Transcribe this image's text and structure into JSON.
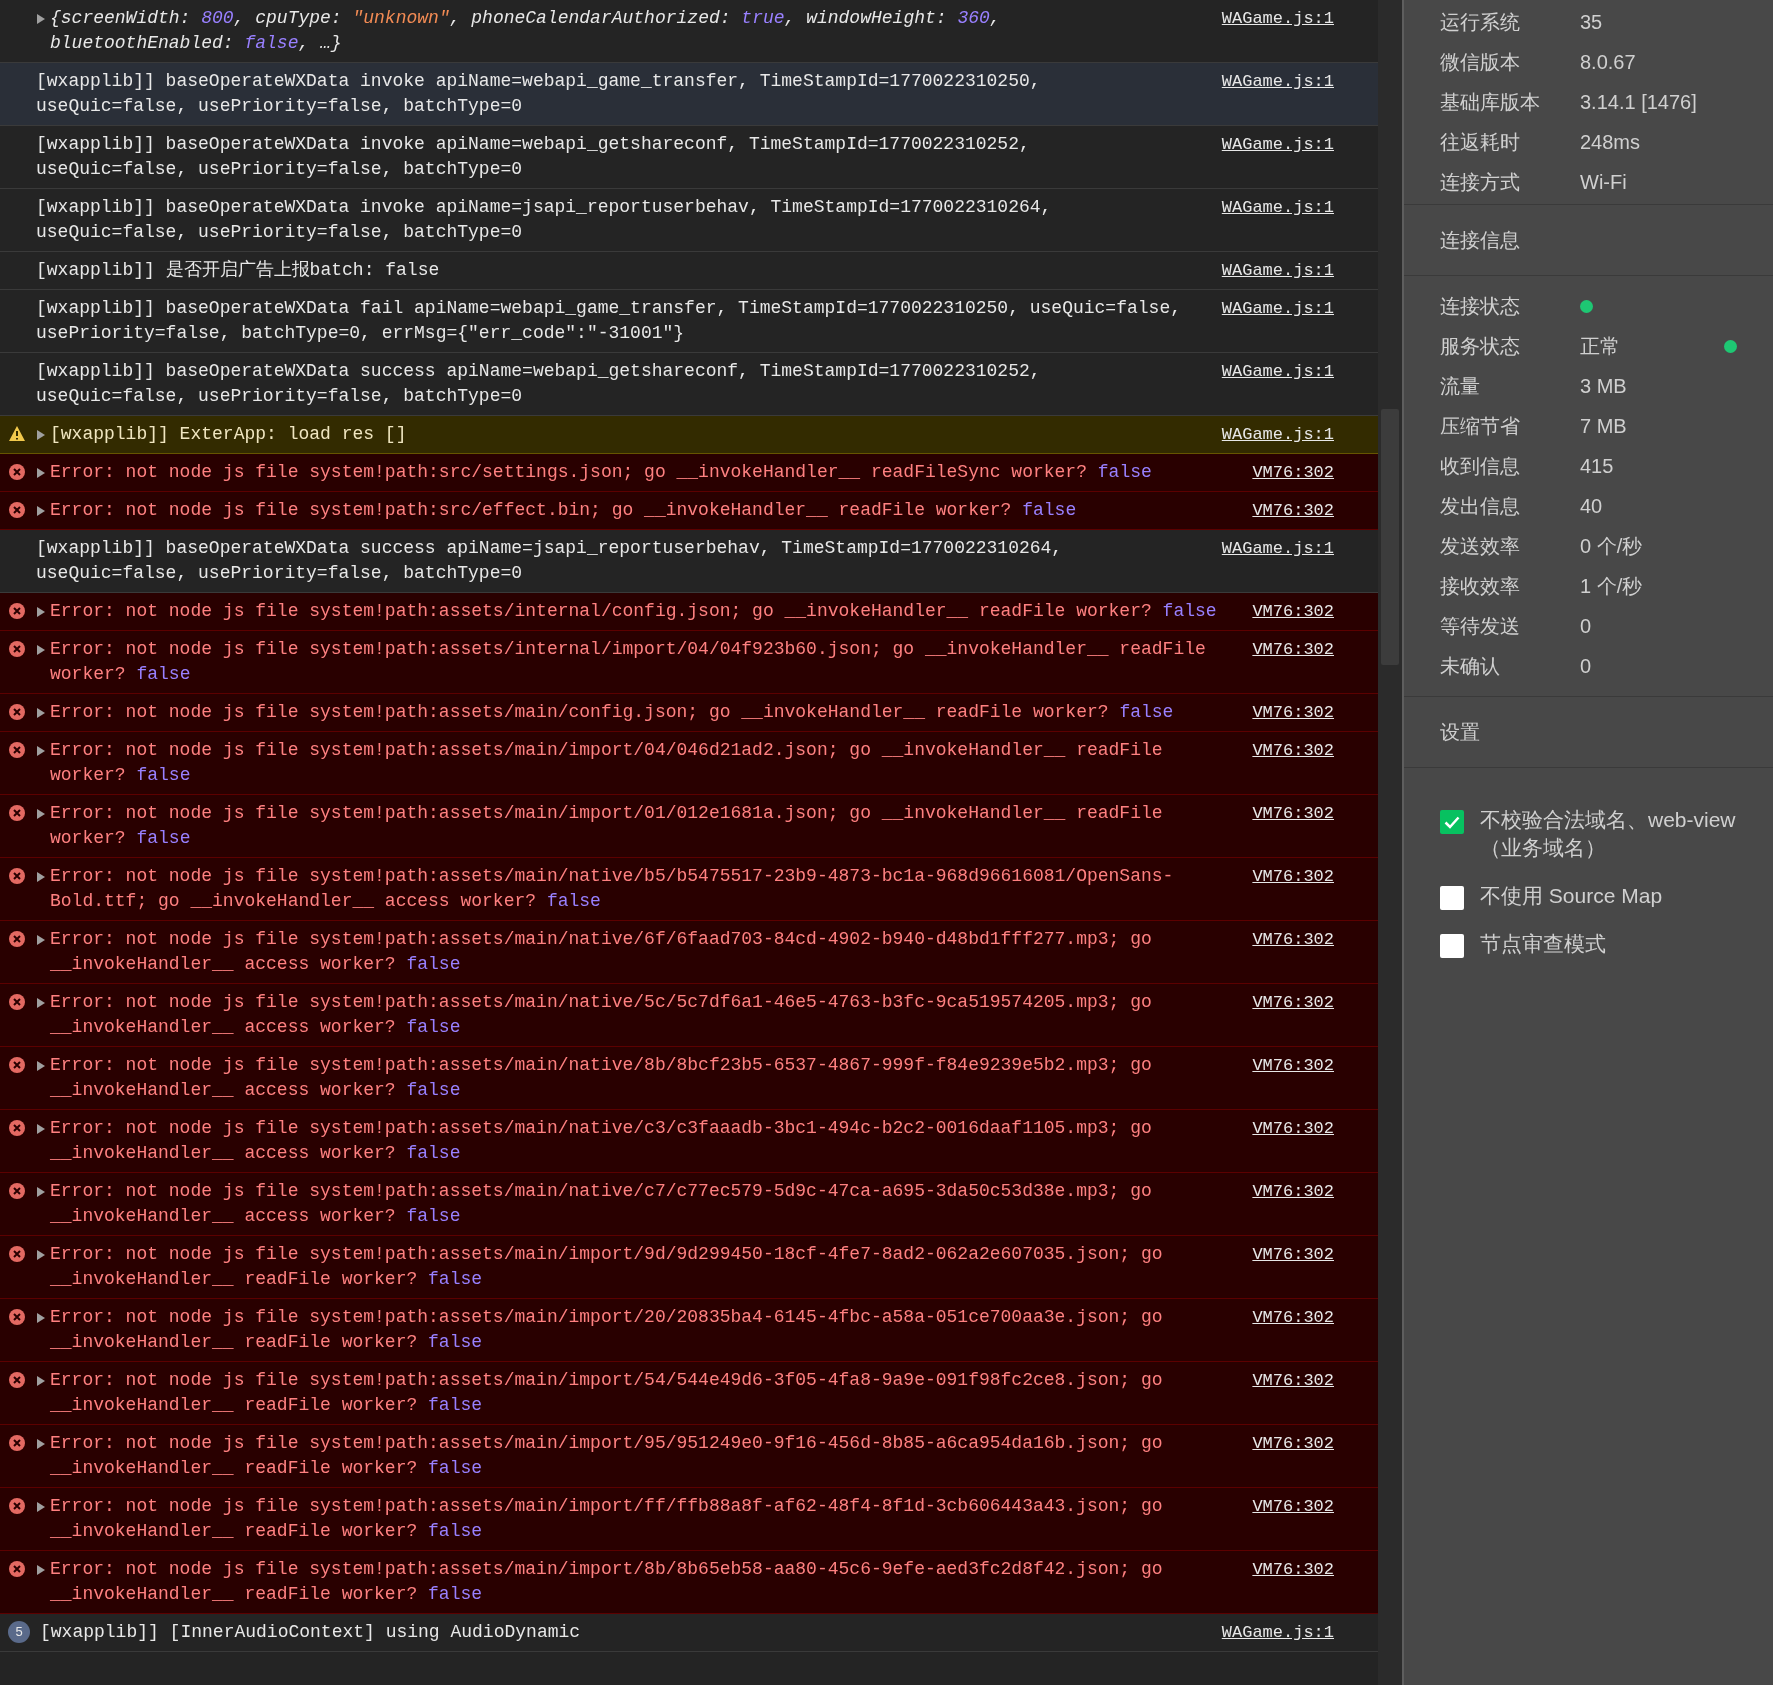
{
  "console": {
    "rows": [
      {
        "kind": "object",
        "selected": false,
        "source": "WAGame.js:1",
        "segments": [
          {
            "text": "{screenWidth: ",
            "kind": "plain"
          },
          {
            "text": "800",
            "kind": "number"
          },
          {
            "text": ", cpuType: ",
            "kind": "plain"
          },
          {
            "text": "\"unknown\"",
            "kind": "string"
          },
          {
            "text": ", phoneCalendarAuthorized: ",
            "kind": "plain"
          },
          {
            "text": "true",
            "kind": "number"
          },
          {
            "text": ", windowHeight: ",
            "kind": "plain"
          },
          {
            "text": "360",
            "kind": "number"
          },
          {
            "text": ", bluetoothEnabled: ",
            "kind": "plain"
          },
          {
            "text": "false",
            "kind": "number"
          },
          {
            "text": ", …}",
            "kind": "plain"
          }
        ]
      },
      {
        "kind": "log",
        "selected": true,
        "source": "WAGame.js:1",
        "segments": [
          {
            "text": "[wxapplib]] baseOperateWXData invoke apiName=webapi_game_transfer, TimeStampId=1770022310250, useQuic=false, usePriority=false, batchType=0",
            "kind": "plain"
          }
        ]
      },
      {
        "kind": "log",
        "selected": false,
        "source": "WAGame.js:1",
        "segments": [
          {
            "text": "[wxapplib]] baseOperateWXData invoke apiName=webapi_getshareconf, TimeStampId=1770022310252, useQuic=false, usePriority=false, batchType=0",
            "kind": "plain"
          }
        ]
      },
      {
        "kind": "log",
        "selected": false,
        "source": "WAGame.js:1",
        "segments": [
          {
            "text": "[wxapplib]] baseOperateWXData invoke apiName=jsapi_reportuserbehav, TimeStampId=1770022310264, useQuic=false, usePriority=false, batchType=0",
            "kind": "plain"
          }
        ]
      },
      {
        "kind": "log",
        "selected": false,
        "source": "WAGame.js:1",
        "segments": [
          {
            "text": "[wxapplib]] 是否开启广告上报batch: false",
            "kind": "plain"
          }
        ]
      },
      {
        "kind": "log",
        "selected": false,
        "source": "WAGame.js:1",
        "segments": [
          {
            "text": "[wxapplib]] baseOperateWXData fail apiName=webapi_game_transfer, TimeStampId=1770022310250, useQuic=false, usePriority=false, batchType=0, errMsg={\"err_code\":\"-31001\"}",
            "kind": "plain"
          }
        ]
      },
      {
        "kind": "log",
        "selected": false,
        "source": "WAGame.js:1",
        "segments": [
          {
            "text": "[wxapplib]] baseOperateWXData success apiName=webapi_getshareconf, TimeStampId=1770022310252, useQuic=false, usePriority=false, batchType=0",
            "kind": "plain"
          }
        ]
      },
      {
        "kind": "warning",
        "selected": false,
        "source": "WAGame.js:1",
        "segments": [
          {
            "text": "[wxapplib]] ExterApp: load res []",
            "kind": "plain"
          }
        ]
      },
      {
        "kind": "error",
        "selected": false,
        "source": "VM76:302",
        "segments": [
          {
            "text": "Error: not node js file system!path:src/settings.json; go __invokeHandler__ readFileSync worker? ",
            "kind": "plain"
          },
          {
            "text": "false",
            "kind": "number"
          }
        ]
      },
      {
        "kind": "error",
        "selected": false,
        "source": "VM76:302",
        "segments": [
          {
            "text": "Error: not node js file system!path:src/effect.bin; go __invokeHandler__ readFile worker? ",
            "kind": "plain"
          },
          {
            "text": "false",
            "kind": "number"
          }
        ]
      },
      {
        "kind": "log",
        "selected": false,
        "source": "WAGame.js:1",
        "segments": [
          {
            "text": "[wxapplib]] baseOperateWXData success apiName=jsapi_reportuserbehav, TimeStampId=1770022310264, useQuic=false, usePriority=false, batchType=0",
            "kind": "plain"
          }
        ]
      },
      {
        "kind": "error",
        "selected": false,
        "source": "VM76:302",
        "segments": [
          {
            "text": "Error: not node js file system!path:assets/internal/config.json; go __invokeHandler__ readFile worker? ",
            "kind": "plain"
          },
          {
            "text": "false",
            "kind": "number"
          }
        ]
      },
      {
        "kind": "error",
        "selected": false,
        "source": "VM76:302",
        "segments": [
          {
            "text": "Error: not node js file system!path:assets/internal/import/04/04f923b60.json; go __invokeHandler__ readFile worker? ",
            "kind": "plain"
          },
          {
            "text": "false",
            "kind": "number"
          }
        ]
      },
      {
        "kind": "error",
        "selected": false,
        "source": "VM76:302",
        "segments": [
          {
            "text": "Error: not node js file system!path:assets/main/config.json; go __invokeHandler__ readFile worker? ",
            "kind": "plain"
          },
          {
            "text": "false",
            "kind": "number"
          }
        ]
      },
      {
        "kind": "error",
        "selected": false,
        "source": "VM76:302",
        "segments": [
          {
            "text": "Error: not node js file system!path:assets/main/import/04/046d21ad2.json; go __invokeHandler__ readFile worker? ",
            "kind": "plain"
          },
          {
            "text": "false",
            "kind": "number"
          }
        ]
      },
      {
        "kind": "error",
        "selected": false,
        "source": "VM76:302",
        "segments": [
          {
            "text": "Error: not node js file system!path:assets/main/import/01/012e1681a.json; go __invokeHandler__ readFile worker? ",
            "kind": "plain"
          },
          {
            "text": "false",
            "kind": "number"
          }
        ]
      },
      {
        "kind": "error",
        "selected": false,
        "source": "VM76:302",
        "segments": [
          {
            "text": "Error: not node js file system!path:assets/main/native/b5/b5475517-23b9-4873-bc1a-968d96616081/OpenSans-Bold.ttf; go __invokeHandler__ access worker? ",
            "kind": "plain"
          },
          {
            "text": "false",
            "kind": "number"
          }
        ]
      },
      {
        "kind": "error",
        "selected": false,
        "source": "VM76:302",
        "segments": [
          {
            "text": "Error: not node js file system!path:assets/main/native/6f/6faad703-84cd-4902-b940-d48bd1fff277.mp3; go __invokeHandler__ access worker? ",
            "kind": "plain"
          },
          {
            "text": "false",
            "kind": "number"
          }
        ]
      },
      {
        "kind": "error",
        "selected": false,
        "source": "VM76:302",
        "segments": [
          {
            "text": "Error: not node js file system!path:assets/main/native/5c/5c7df6a1-46e5-4763-b3fc-9ca519574205.mp3; go __invokeHandler__ access worker? ",
            "kind": "plain"
          },
          {
            "text": "false",
            "kind": "number"
          }
        ]
      },
      {
        "kind": "error",
        "selected": false,
        "source": "VM76:302",
        "segments": [
          {
            "text": "Error: not node js file system!path:assets/main/native/8b/8bcf23b5-6537-4867-999f-f84e9239e5b2.mp3; go __invokeHandler__ access worker? ",
            "kind": "plain"
          },
          {
            "text": "false",
            "kind": "number"
          }
        ]
      },
      {
        "kind": "error",
        "selected": false,
        "source": "VM76:302",
        "segments": [
          {
            "text": "Error: not node js file system!path:assets/main/native/c3/c3faaadb-3bc1-494c-b2c2-0016daaf1105.mp3; go __invokeHandler__ access worker? ",
            "kind": "plain"
          },
          {
            "text": "false",
            "kind": "number"
          }
        ]
      },
      {
        "kind": "error",
        "selected": false,
        "source": "VM76:302",
        "segments": [
          {
            "text": "Error: not node js file system!path:assets/main/native/c7/c77ec579-5d9c-47ca-a695-3da50c53d38e.mp3; go __invokeHandler__ access worker? ",
            "kind": "plain"
          },
          {
            "text": "false",
            "kind": "number"
          }
        ]
      },
      {
        "kind": "error",
        "selected": false,
        "source": "VM76:302",
        "segments": [
          {
            "text": "Error: not node js file system!path:assets/main/import/9d/9d299450-18cf-4fe7-8ad2-062a2e607035.json; go __invokeHandler__ readFile worker? ",
            "kind": "plain"
          },
          {
            "text": "false",
            "kind": "number"
          }
        ]
      },
      {
        "kind": "error",
        "selected": false,
        "source": "VM76:302",
        "segments": [
          {
            "text": "Error: not node js file system!path:assets/main/import/20/20835ba4-6145-4fbc-a58a-051ce700aa3e.json; go __invokeHandler__ readFile worker? ",
            "kind": "plain"
          },
          {
            "text": "false",
            "kind": "number"
          }
        ]
      },
      {
        "kind": "error",
        "selected": false,
        "source": "VM76:302",
        "segments": [
          {
            "text": "Error: not node js file system!path:assets/main/import/54/544e49d6-3f05-4fa8-9a9e-091f98fc2ce8.json; go __invokeHandler__ readFile worker? ",
            "kind": "plain"
          },
          {
            "text": "false",
            "kind": "number"
          }
        ]
      },
      {
        "kind": "error",
        "selected": false,
        "source": "VM76:302",
        "segments": [
          {
            "text": "Error: not node js file system!path:assets/main/import/95/951249e0-9f16-456d-8b85-a6ca954da16b.json; go __invokeHandler__ readFile worker? ",
            "kind": "plain"
          },
          {
            "text": "false",
            "kind": "number"
          }
        ]
      },
      {
        "kind": "error",
        "selected": false,
        "source": "VM76:302",
        "segments": [
          {
            "text": "Error: not node js file system!path:assets/main/import/ff/ffb88a8f-af62-48f4-8f1d-3cb606443a43.json; go __invokeHandler__ readFile worker? ",
            "kind": "plain"
          },
          {
            "text": "false",
            "kind": "number"
          }
        ]
      },
      {
        "kind": "error",
        "selected": false,
        "source": "VM76:302",
        "segments": [
          {
            "text": "Error: not node js file system!path:assets/main/import/8b/8b65eb58-aa80-45c6-9efe-aed3fc2d8f42.json; go __invokeHandler__ readFile worker? ",
            "kind": "plain"
          },
          {
            "text": "false",
            "kind": "number"
          }
        ]
      },
      {
        "kind": "repeated",
        "selected": false,
        "count": "5",
        "source": "WAGame.js:1",
        "segments": [
          {
            "text": "[wxapplib]] [InnerAudioContext] using AudioDynamic",
            "kind": "plain"
          }
        ]
      }
    ]
  },
  "info_panel": {
    "system_rows": [
      {
        "label": "运行系统",
        "value": "35"
      },
      {
        "label": "微信版本",
        "value": "8.0.67"
      },
      {
        "label": "基础库版本",
        "value": "3.14.1 [1476]"
      },
      {
        "label": "往返耗时",
        "value": "248ms"
      },
      {
        "label": "连接方式",
        "value": "Wi-Fi"
      }
    ],
    "connection_title": "连接信息",
    "connection_rows": [
      {
        "kind": "dot",
        "label": "连接状态",
        "color": "#1ec773"
      },
      {
        "kind": "text_dot",
        "label": "服务状态",
        "value": "正常",
        "color": "#1ec773"
      },
      {
        "kind": "text",
        "label": "流量",
        "value": "3 MB"
      },
      {
        "kind": "text",
        "label": "压缩节省",
        "value": "7 MB"
      },
      {
        "kind": "text",
        "label": "收到信息",
        "value": "415"
      },
      {
        "kind": "text",
        "label": "发出信息",
        "value": "40"
      },
      {
        "kind": "text",
        "label": "发送效率",
        "value": "0 个/秒"
      },
      {
        "kind": "text",
        "label": "接收效率",
        "value": "1 个/秒"
      },
      {
        "kind": "text",
        "label": "等待发送",
        "value": "0"
      },
      {
        "kind": "text",
        "label": "未确认",
        "value": "0"
      }
    ],
    "settings_title": "设置",
    "settings": [
      {
        "label": "不校验合法域名、web-view（业务域名）",
        "checked": true
      },
      {
        "label": "不使用 Source Map",
        "checked": false
      },
      {
        "label": "节点审查模式",
        "checked": false
      }
    ]
  }
}
